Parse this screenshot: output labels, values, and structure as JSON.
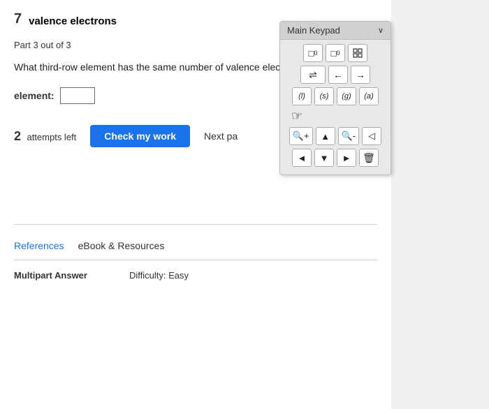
{
  "page": {
    "valence_title": "valence electrons",
    "part_num": "7",
    "part_info": "Part 3 out of 3",
    "question": "What third-row element has the same number of valence electrons as fluorine?",
    "element_label": "element:",
    "element_placeholder": "",
    "attempts_num": "2",
    "attempts_label": "attempts left",
    "check_btn": "Check my work",
    "next_btn": "Next pa",
    "references_link": "References",
    "ebook_link": "eBook & Resources",
    "multipart_label": "Multipart Answer",
    "difficulty": "Difficulty: Easy"
  },
  "keypad": {
    "header_label": "Main Keypad",
    "chevron": "∨",
    "row1": [
      "□°",
      "□₀",
      "⊞"
    ],
    "row2": [
      "⇌",
      "←",
      "→"
    ],
    "row3": [
      "(l)",
      "(s)",
      "(g)",
      "(a)"
    ],
    "row4": [
      "🔍+",
      "▲",
      "🔍-",
      "◁"
    ],
    "row5": [
      "◄",
      "▼",
      "►",
      "🗑"
    ]
  }
}
